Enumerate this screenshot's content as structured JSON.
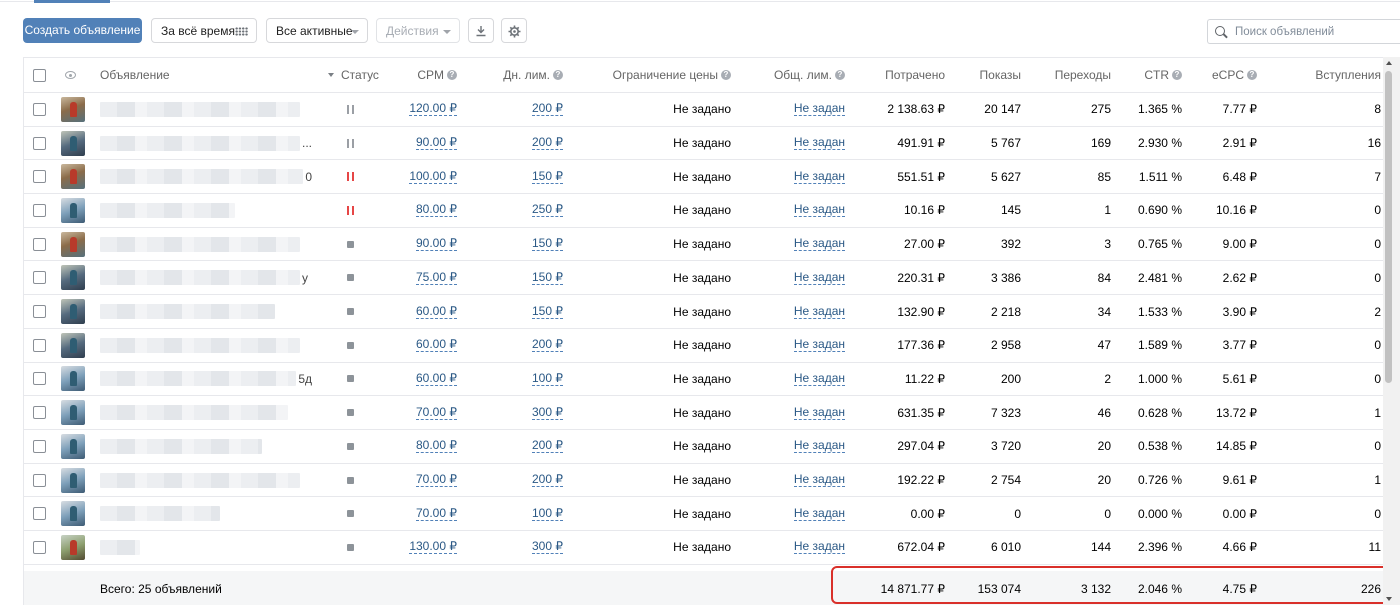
{
  "toolbar": {
    "create_label": "Создать объявление",
    "period_label": "За всё время",
    "filter_label": "Все активные",
    "actions_label": "Действия"
  },
  "search": {
    "placeholder": "Поиск объявлений"
  },
  "headers": {
    "ad": "Объявление",
    "status": "Статус",
    "cpm": "CPM",
    "daily_limit": "Дн. лим.",
    "price_limit": "Ограничение цены",
    "total_limit": "Общ. лим.",
    "spent": "Потрачено",
    "views": "Показы",
    "clicks": "Переходы",
    "ctr": "CTR",
    "ecpc": "eCPC",
    "joins": "Вступления"
  },
  "rows": [
    {
      "thumb": "red-figure",
      "name_suffix": "",
      "status": "paused",
      "cpm": "120.00 ₽",
      "daily_limit": "200 ₽",
      "price_limit": "Не задано",
      "total_limit": "Не задан",
      "spent": "2 138.63 ₽",
      "views": "20 147",
      "clicks": "275",
      "ctr": "1.365 %",
      "ecpc": "7.77 ₽",
      "joins": "8"
    },
    {
      "thumb": "dark-figure",
      "name_suffix": "...",
      "status": "paused",
      "cpm": "90.00 ₽",
      "daily_limit": "200 ₽",
      "price_limit": "Не задано",
      "total_limit": "Не задан",
      "spent": "491.91 ₽",
      "views": "5 767",
      "clicks": "169",
      "ctr": "2.930 %",
      "ecpc": "2.91 ₽",
      "joins": "16"
    },
    {
      "thumb": "red-figure",
      "name_suffix": "0",
      "status": "paused-red",
      "cpm": "100.00 ₽",
      "daily_limit": "150 ₽",
      "price_limit": "Не задано",
      "total_limit": "Не задан",
      "spent": "551.51 ₽",
      "views": "5 627",
      "clicks": "85",
      "ctr": "1.511 %",
      "ecpc": "6.48 ₽",
      "joins": "7"
    },
    {
      "thumb": "blue-figure",
      "name_suffix": "",
      "status": "paused-red",
      "cpm": "80.00 ₽",
      "daily_limit": "250 ₽",
      "price_limit": "Не задано",
      "total_limit": "Не задан",
      "spent": "10.16 ₽",
      "views": "145",
      "clicks": "1",
      "ctr": "0.690 %",
      "ecpc": "10.16 ₽",
      "joins": "0"
    },
    {
      "thumb": "red-figure",
      "name_suffix": "",
      "status": "stopped",
      "cpm": "90.00 ₽",
      "daily_limit": "150 ₽",
      "price_limit": "Не задано",
      "total_limit": "Не задан",
      "spent": "27.00 ₽",
      "views": "392",
      "clicks": "3",
      "ctr": "0.765 %",
      "ecpc": "9.00 ₽",
      "joins": "0"
    },
    {
      "thumb": "dark-figure",
      "name_suffix": "у",
      "status": "stopped",
      "cpm": "75.00 ₽",
      "daily_limit": "150 ₽",
      "price_limit": "Не задано",
      "total_limit": "Не задан",
      "spent": "220.31 ₽",
      "views": "3 386",
      "clicks": "84",
      "ctr": "2.481 %",
      "ecpc": "2.62 ₽",
      "joins": "0"
    },
    {
      "thumb": "dark-figure",
      "name_suffix": "",
      "status": "stopped",
      "cpm": "60.00 ₽",
      "daily_limit": "150 ₽",
      "price_limit": "Не задано",
      "total_limit": "Не задан",
      "spent": "132.90 ₽",
      "views": "2 218",
      "clicks": "34",
      "ctr": "1.533 %",
      "ecpc": "3.90 ₽",
      "joins": "2"
    },
    {
      "thumb": "dark-figure",
      "name_suffix": "",
      "status": "stopped",
      "cpm": "60.00 ₽",
      "daily_limit": "200 ₽",
      "price_limit": "Не задано",
      "total_limit": "Не задан",
      "spent": "177.36 ₽",
      "views": "2 958",
      "clicks": "47",
      "ctr": "1.589 %",
      "ecpc": "3.77 ₽",
      "joins": "0"
    },
    {
      "thumb": "blue-figure",
      "name_suffix": "5д",
      "status": "stopped",
      "cpm": "60.00 ₽",
      "daily_limit": "100 ₽",
      "price_limit": "Не задано",
      "total_limit": "Не задан",
      "spent": "11.22 ₽",
      "views": "200",
      "clicks": "2",
      "ctr": "1.000 %",
      "ecpc": "5.61 ₽",
      "joins": "0"
    },
    {
      "thumb": "blue-figure",
      "name_suffix": "",
      "status": "stopped",
      "cpm": "70.00 ₽",
      "daily_limit": "300 ₽",
      "price_limit": "Не задано",
      "total_limit": "Не задан",
      "spent": "631.35 ₽",
      "views": "7 323",
      "clicks": "46",
      "ctr": "0.628 %",
      "ecpc": "13.72 ₽",
      "joins": "1"
    },
    {
      "thumb": "blue-figure",
      "name_suffix": "",
      "status": "stopped",
      "cpm": "80.00 ₽",
      "daily_limit": "200 ₽",
      "price_limit": "Не задано",
      "total_limit": "Не задан",
      "spent": "297.04 ₽",
      "views": "3 720",
      "clicks": "20",
      "ctr": "0.538 %",
      "ecpc": "14.85 ₽",
      "joins": "0"
    },
    {
      "thumb": "blue-figure",
      "name_suffix": "",
      "status": "stopped",
      "cpm": "70.00 ₽",
      "daily_limit": "200 ₽",
      "price_limit": "Не задано",
      "total_limit": "Не задан",
      "spent": "192.22 ₽",
      "views": "2 754",
      "clicks": "20",
      "ctr": "0.726 %",
      "ecpc": "9.61 ₽",
      "joins": "1"
    },
    {
      "thumb": "blue-figure",
      "name_suffix": "",
      "status": "stopped",
      "cpm": "70.00 ₽",
      "daily_limit": "100 ₽",
      "price_limit": "Не задано",
      "total_limit": "Не задан",
      "spent": "0.00 ₽",
      "views": "0",
      "clicks": "0",
      "ctr": "0.000 %",
      "ecpc": "0.00 ₽",
      "joins": "0"
    },
    {
      "thumb": "green-figure",
      "name_suffix": "",
      "status": "stopped",
      "cpm": "130.00 ₽",
      "daily_limit": "300 ₽",
      "price_limit": "Не задано",
      "total_limit": "Не задан",
      "spent": "672.04 ₽",
      "views": "6 010",
      "clicks": "144",
      "ctr": "2.396 %",
      "ecpc": "4.66 ₽",
      "joins": "11"
    }
  ],
  "footer": {
    "total_label": "Всего: 25 объявлений",
    "spent": "14 871.77 ₽",
    "views": "153 074",
    "clicks": "3 132",
    "ctr": "2.046 %",
    "ecpc": "4.75 ₽",
    "joins": "226"
  },
  "colors": {
    "accent": "#5181b8",
    "link": "#2a5885",
    "pause_red": "#e64646",
    "highlight": "#d9302a"
  }
}
